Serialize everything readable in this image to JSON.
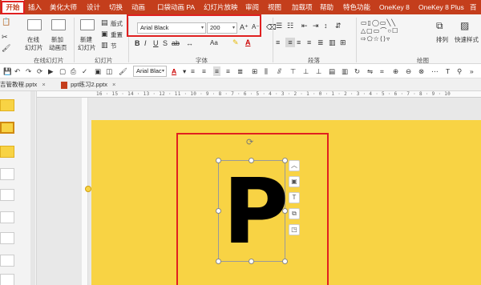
{
  "menu": {
    "items": [
      {
        "label": "开始",
        "active": true
      },
      {
        "label": "插入"
      },
      {
        "label": "美化大师"
      },
      {
        "label": "设计"
      },
      {
        "label": "切换"
      },
      {
        "label": "动画"
      },
      {
        "label": "口袋动画 PA"
      },
      {
        "label": "幻灯片放映"
      },
      {
        "label": "审阅"
      },
      {
        "label": "视图"
      },
      {
        "label": "加载项"
      },
      {
        "label": "帮助"
      },
      {
        "label": "特色功能"
      },
      {
        "label": "OneKey 8"
      },
      {
        "label": "OneKey 8 Plus"
      },
      {
        "label": "百"
      }
    ]
  },
  "ribbon": {
    "new_window_label_line1": "在线",
    "new_window_label_line2": "幻灯片",
    "new_slide_label_line1": "新建",
    "new_slide_label_line2": "幻灯片",
    "add_anim_label_line1": "新加",
    "add_anim_label_line2": "动画页",
    "layout_label": "版式",
    "reset_label": "重置",
    "section_label": "节",
    "group_online_slides": "在线幻灯片",
    "group_slides": "幻灯片",
    "group_font": "字体",
    "group_paragraph": "段落",
    "group_drawing": "绘图",
    "font_name": "Arial Black",
    "font_size": "200",
    "grow_font": "A⁺",
    "shrink_font": "A⁻",
    "arrange_label": "排列",
    "quick_styles_label": "快速样式",
    "aa_label": "Aa"
  },
  "minibar": {
    "font_name": "Arial Blac"
  },
  "tabs": [
    {
      "label": "吉管教程.pptx",
      "closable": true
    },
    {
      "label": "ppt练习2.pptx",
      "closable": true
    }
  ],
  "ruler": {
    "text": "16 · 15 · 14 · 13 · 12 · 11 · 10 · 9 · 8 · 7 · 6 · 5 · 4 · 3 · 2 · 1 · 0 · 1 · 2 · 3 · 4 · 5 · 6 · 7 · 8 · 9 · 10"
  },
  "slide": {
    "big_letter": "P",
    "background_color": "#f8d344"
  },
  "colors": {
    "accent": "#c43e1c",
    "highlight": "#e02020",
    "slide_bg": "#f8d344"
  }
}
